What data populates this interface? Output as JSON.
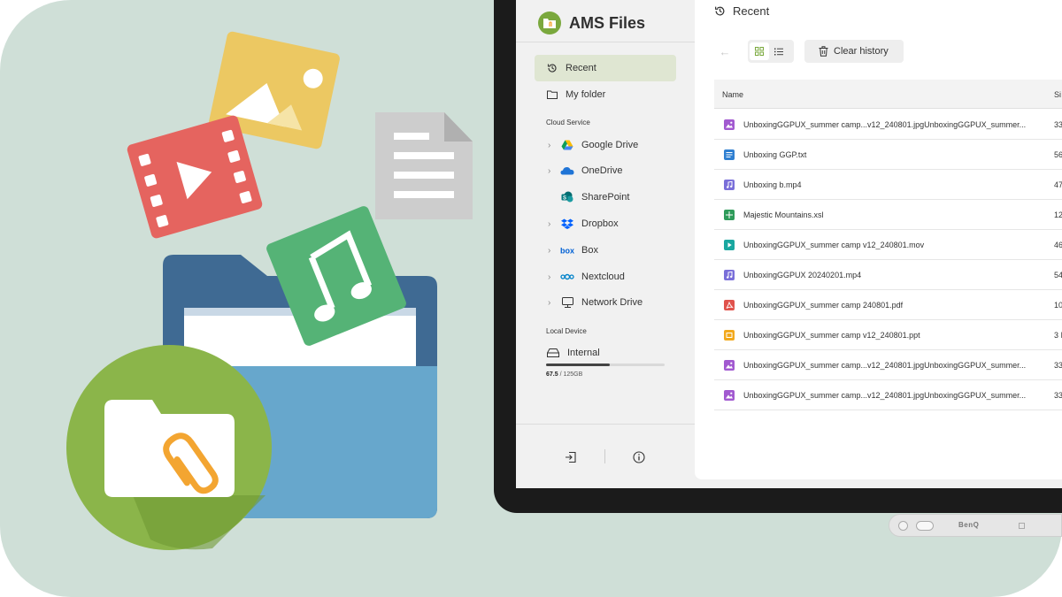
{
  "app": {
    "title": "AMS Files",
    "accent_color": "#7aa83d"
  },
  "sidebar": {
    "nav": [
      {
        "label": "Recent",
        "icon": "history-icon",
        "active": true
      },
      {
        "label": "My folder",
        "icon": "folder-icon",
        "active": false
      }
    ],
    "cloud_section_label": "Cloud Service",
    "cloud_items": [
      {
        "label": "Google Drive",
        "icon": "google-drive-icon",
        "expandable": true
      },
      {
        "label": "OneDrive",
        "icon": "onedrive-icon",
        "expandable": true
      },
      {
        "label": "SharePoint",
        "icon": "sharepoint-icon",
        "expandable": false
      },
      {
        "label": "Dropbox",
        "icon": "dropbox-icon",
        "expandable": true
      },
      {
        "label": "Box",
        "icon": "box-icon",
        "expandable": true
      },
      {
        "label": "Nextcloud",
        "icon": "nextcloud-icon",
        "expandable": true
      },
      {
        "label": "Network Drive",
        "icon": "network-drive-icon",
        "expandable": true
      }
    ],
    "local_section_label": "Local Device",
    "local_items": [
      {
        "label": "Internal",
        "icon": "hard-drive-icon"
      }
    ],
    "storage": {
      "used": "67.5",
      "total": " / 125GB",
      "fraction": 0.54
    },
    "footer": {
      "exit_icon": "exit-icon",
      "info_icon": "info-icon"
    }
  },
  "main": {
    "title": "Recent",
    "toolbar": {
      "back_icon": "arrow-left-icon",
      "grid_icon": "grid-view-icon",
      "list_icon": "list-view-icon",
      "clear_label": "Clear history"
    },
    "columns": {
      "name": "Name",
      "size": "Si"
    },
    "files": [
      {
        "name": "UnboxingGGPUX_summer camp...v12_240801.jpgUnboxingGGPUX_summer...",
        "size": "33",
        "type": "image",
        "color": "#a25ad0"
      },
      {
        "name": "Unboxing GGP.txt",
        "size": "56",
        "type": "text",
        "color": "#2f7fd1"
      },
      {
        "name": "Unboxing b.mp4",
        "size": "47",
        "type": "audio",
        "color": "#7a6fd9"
      },
      {
        "name": "Majestic Mountains.xsl",
        "size": "12",
        "type": "sheet",
        "color": "#2e9b5a"
      },
      {
        "name": "UnboxingGGPUX_summer camp v12_240801.mov",
        "size": "46",
        "type": "video",
        "color": "#1aa7a0"
      },
      {
        "name": "UnboxingGGPUX 20240201.mp4",
        "size": "54",
        "type": "audio",
        "color": "#7a6fd9"
      },
      {
        "name": "UnboxingGGPUX_summer camp 240801.pdf",
        "size": "10",
        "type": "pdf",
        "color": "#e0524c"
      },
      {
        "name": "UnboxingGGPUX_summer camp v12_240801.ppt",
        "size": "3 I",
        "type": "slides",
        "color": "#f2a91d"
      },
      {
        "name": "UnboxingGGPUX_summer camp...v12_240801.jpgUnboxingGGPUX_summer...",
        "size": "33",
        "type": "image",
        "color": "#a25ad0"
      },
      {
        "name": "UnboxingGGPUX_summer camp...v12_240801.jpgUnboxingGGPUX_summer...",
        "size": "33",
        "type": "image",
        "color": "#a25ad0"
      }
    ]
  },
  "device": {
    "brand": "BenQ"
  }
}
